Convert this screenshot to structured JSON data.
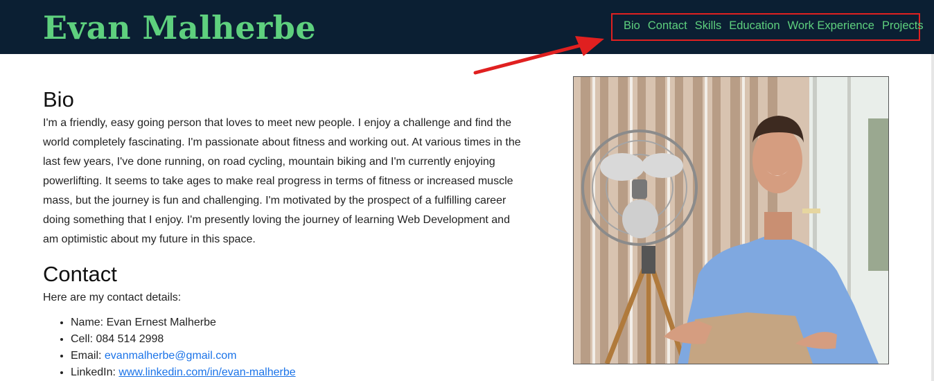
{
  "header": {
    "site_title": "Evan Malherbe",
    "nav": [
      "Bio",
      "Contact",
      "Skills",
      "Education",
      "Work Experience",
      "Projects"
    ]
  },
  "bio": {
    "heading": "Bio",
    "text": "I'm a friendly, easy going person that loves to meet new people. I enjoy a challenge and find the world completely fascinating. I'm passionate about fitness and working out. At various times in the last few years, I've done running, on road cycling, mountain biking and I'm currently enjoying powerlifting. It seems to take ages to make real progress in terms of fitness or increased muscle mass, but the journey is fun and challenging. I'm motivated by the prospect of a fulfilling career doing something that I enjoy. I'm presently loving the journey of learning Web Development and am optimistic about my future in this space."
  },
  "contact": {
    "heading": "Contact",
    "intro": "Here are my contact details:",
    "name_label": "Name: ",
    "name_value": "Evan Ernest Malherbe",
    "cell_label": "Cell: ",
    "cell_value": "084 514 2998",
    "email_label": "Email: ",
    "email_value": "evanmalherbe@gmail.com",
    "linkedin_label": "LinkedIn: ",
    "linkedin_value": "www.linkedin.com/in/evan-malherbe"
  },
  "colors": {
    "header_bg": "#0b1f33",
    "accent": "#5ed07e",
    "annotation": "#e02020",
    "link": "#1a73e8"
  }
}
